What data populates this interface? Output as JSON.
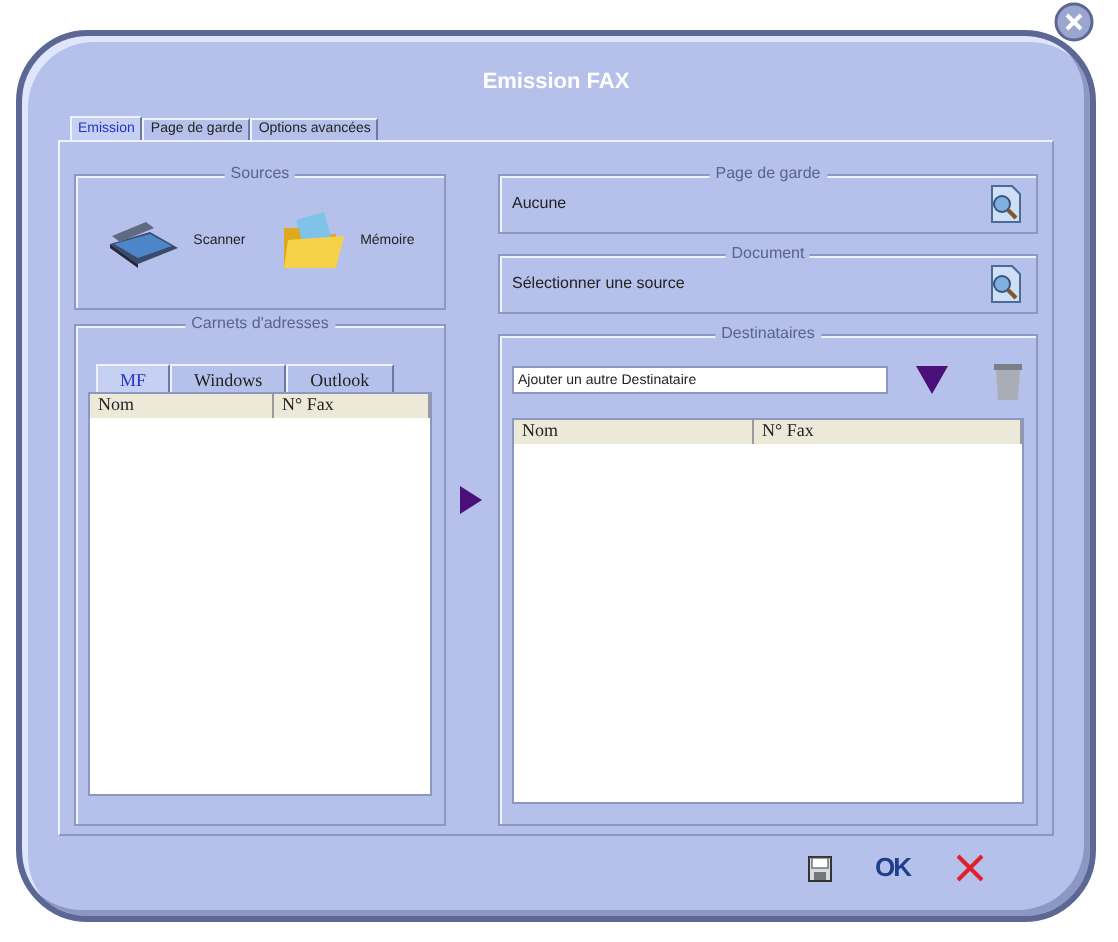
{
  "window": {
    "title": "Emission FAX"
  },
  "tabs": [
    {
      "label": "Emission",
      "selected": true
    },
    {
      "label": "Page de garde",
      "selected": false
    },
    {
      "label": "Options avancées",
      "selected": false
    }
  ],
  "sources": {
    "title": "Sources",
    "items": [
      {
        "kind": "scanner",
        "label": "Scanner"
      },
      {
        "kind": "memory",
        "label": "Mémoire"
      }
    ]
  },
  "address_books": {
    "title": "Carnets d'adresses",
    "tabs": [
      {
        "label": "MF",
        "selected": true
      },
      {
        "label": "Windows",
        "selected": false
      },
      {
        "label": "Outlook",
        "selected": false
      }
    ],
    "columns": [
      "Nom",
      "N° Fax"
    ]
  },
  "cover_page": {
    "title": "Page de garde",
    "value": "Aucune"
  },
  "document": {
    "title": "Document",
    "value": "Sélectionner une source"
  },
  "recipients": {
    "title": "Destinataires",
    "input": "Ajouter un autre Destinataire",
    "columns": [
      "Nom",
      "N° Fax"
    ]
  },
  "buttons": [
    {
      "kind": "save"
    },
    {
      "kind": "ok",
      "label": "OK"
    },
    {
      "kind": "cancel"
    }
  ]
}
